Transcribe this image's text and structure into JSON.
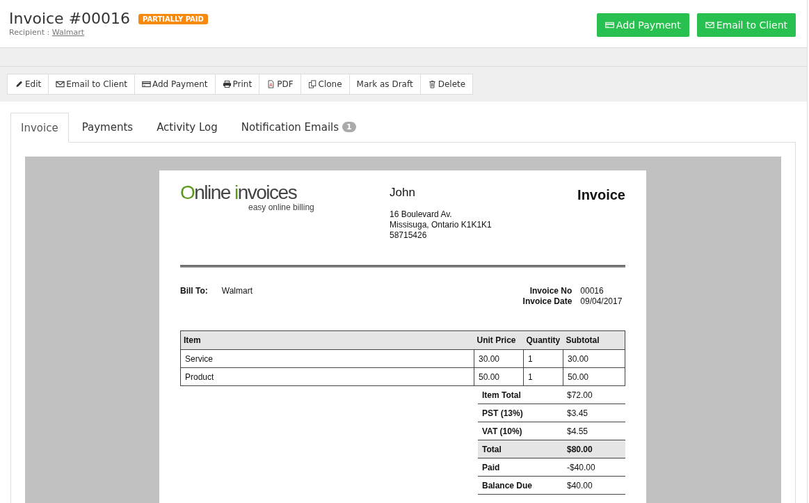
{
  "header": {
    "title": "Invoice #00016",
    "status_badge": "PARTIALLY PAID",
    "recipient_label": "Recipient :",
    "recipient_link": "Walmart",
    "actions": [
      {
        "label": "Add Payment",
        "kind": "card"
      },
      {
        "label": "Email to Client",
        "kind": "email"
      }
    ]
  },
  "toolbar": [
    {
      "label": "Edit",
      "kind": "edit"
    },
    {
      "label": "Email to Client",
      "kind": "email"
    },
    {
      "label": "Add Payment",
      "kind": "card"
    },
    {
      "label": "Print",
      "kind": "print"
    },
    {
      "label": "PDF",
      "kind": "pdf"
    },
    {
      "label": "Clone",
      "kind": "clone"
    },
    {
      "label": "Mark as Draft",
      "kind": "plain"
    },
    {
      "label": "Delete",
      "kind": "trash"
    }
  ],
  "tabs": [
    {
      "label": "Invoice",
      "selected": true
    },
    {
      "label": "Payments",
      "selected": false
    },
    {
      "label": "Activity Log",
      "selected": false
    },
    {
      "label": "Notification Emails",
      "selected": false,
      "badge": "1"
    }
  ],
  "document": {
    "logo": {
      "parts": [
        {
          "text": "O",
          "accent": true
        },
        {
          "text": "nline",
          "accent": false
        },
        {
          "text": "i",
          "accent": true
        },
        {
          "text": "nvoices",
          "accent": false
        }
      ],
      "tagline": "easy online billing"
    },
    "sender": {
      "name": "John",
      "address_lines": [
        "16 Boulevard Av.",
        "Missisuga, Ontario K1K1K1",
        "58715426"
      ]
    },
    "doc_title": "Invoice",
    "bill_to_label": "Bill To:",
    "bill_to": "Walmart",
    "meta": [
      {
        "label": "Invoice No",
        "value": "00016"
      },
      {
        "label": "Invoice Date",
        "value": "09/04/2017"
      }
    ],
    "columns": [
      "Item",
      "Unit Price",
      "Quantity",
      "Subtotal"
    ],
    "rows": [
      [
        "Service",
        "30.00",
        "1",
        "30.00"
      ],
      [
        "Product",
        "50.00",
        "1",
        "50.00"
      ]
    ],
    "totals": [
      {
        "label": "Item Total",
        "value": "$72.00",
        "emphasized": false
      },
      {
        "label": "PST (13%)",
        "value": "$3.45",
        "emphasized": false
      },
      {
        "label": "VAT (10%)",
        "value": "$4.55",
        "emphasized": false
      },
      {
        "label": "Total",
        "value": "$80.00",
        "emphasized": true
      },
      {
        "label": "Paid",
        "value": "-$40.00",
        "emphasized": false
      },
      {
        "label": "Balance Due",
        "value": "$40.00",
        "emphasized": false
      }
    ]
  }
}
